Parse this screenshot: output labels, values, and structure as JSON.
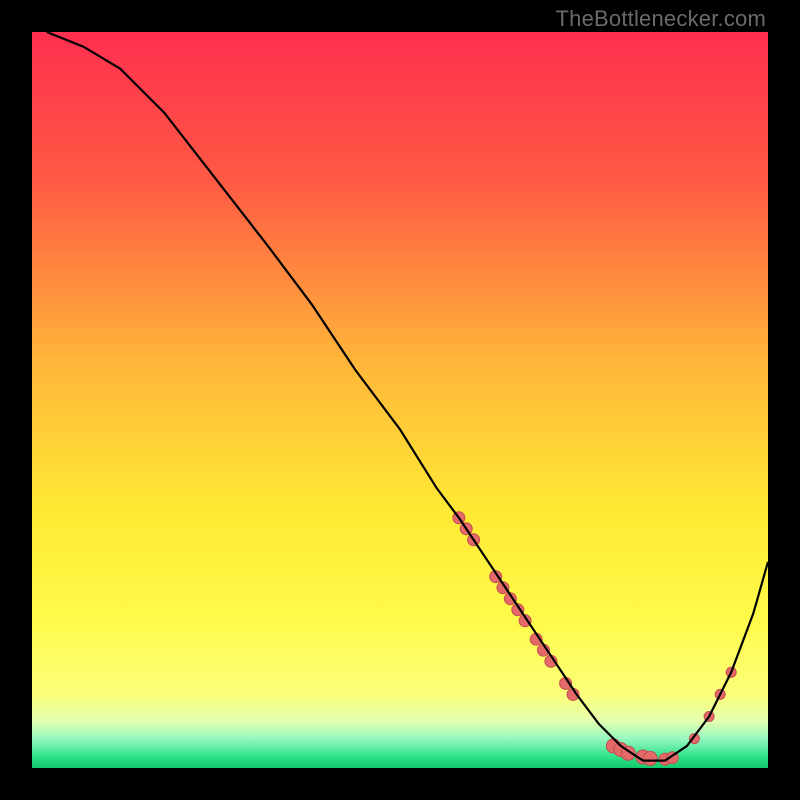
{
  "watermark": "TheBottlenecker.com",
  "chart_data": {
    "type": "line",
    "title": "",
    "xlabel": "",
    "ylabel": "",
    "xlim": [
      0,
      100
    ],
    "ylim": [
      0,
      100
    ],
    "background_gradient": {
      "stops": [
        {
          "offset": 0.0,
          "color": "#ff2f4f"
        },
        {
          "offset": 0.2,
          "color": "#ff5944"
        },
        {
          "offset": 0.45,
          "color": "#ffb63a"
        },
        {
          "offset": 0.65,
          "color": "#ffe934"
        },
        {
          "offset": 0.8,
          "color": "#fffb4a"
        },
        {
          "offset": 0.9,
          "color": "#fbff7a"
        },
        {
          "offset": 0.935,
          "color": "#e6ffad"
        },
        {
          "offset": 0.96,
          "color": "#97f7c0"
        },
        {
          "offset": 0.985,
          "color": "#2de28a"
        },
        {
          "offset": 1.0,
          "color": "#10c86b"
        }
      ]
    },
    "series": [
      {
        "name": "bottleneck-curve",
        "color": "#000000",
        "stroke_width": 2.2,
        "x": [
          2,
          7,
          12,
          18,
          25,
          32,
          38,
          44,
          50,
          55,
          58,
          62,
          66,
          70,
          74,
          77,
          80,
          83,
          86,
          89,
          92,
          95,
          98,
          100
        ],
        "values": [
          100,
          98,
          95,
          89,
          80,
          71,
          63,
          54,
          46,
          38,
          34,
          28,
          22,
          16,
          10,
          6,
          3,
          1,
          1,
          3,
          7,
          13,
          21,
          28
        ]
      }
    ],
    "markers": {
      "color": "#e46a6a",
      "stroke": "#c24d4d",
      "points": [
        {
          "x": 58,
          "y": 34,
          "r": 6
        },
        {
          "x": 59,
          "y": 32.5,
          "r": 6
        },
        {
          "x": 60,
          "y": 31,
          "r": 6
        },
        {
          "x": 63,
          "y": 26,
          "r": 6
        },
        {
          "x": 64,
          "y": 24.5,
          "r": 6
        },
        {
          "x": 65,
          "y": 23,
          "r": 6
        },
        {
          "x": 66,
          "y": 21.5,
          "r": 6
        },
        {
          "x": 67,
          "y": 20,
          "r": 6
        },
        {
          "x": 68.5,
          "y": 17.5,
          "r": 6
        },
        {
          "x": 69.5,
          "y": 16,
          "r": 6
        },
        {
          "x": 70.5,
          "y": 14.5,
          "r": 6
        },
        {
          "x": 72.5,
          "y": 11.5,
          "r": 6
        },
        {
          "x": 73.5,
          "y": 10,
          "r": 6
        },
        {
          "x": 79,
          "y": 3,
          "r": 7
        },
        {
          "x": 80,
          "y": 2.5,
          "r": 7
        },
        {
          "x": 81,
          "y": 2,
          "r": 7
        },
        {
          "x": 83,
          "y": 1.5,
          "r": 7
        },
        {
          "x": 84,
          "y": 1.3,
          "r": 7
        },
        {
          "x": 86,
          "y": 1.2,
          "r": 6
        },
        {
          "x": 87,
          "y": 1.4,
          "r": 6
        },
        {
          "x": 90,
          "y": 4,
          "r": 5
        },
        {
          "x": 92,
          "y": 7,
          "r": 5
        },
        {
          "x": 93.5,
          "y": 10,
          "r": 5
        },
        {
          "x": 95,
          "y": 13,
          "r": 5
        }
      ]
    }
  }
}
